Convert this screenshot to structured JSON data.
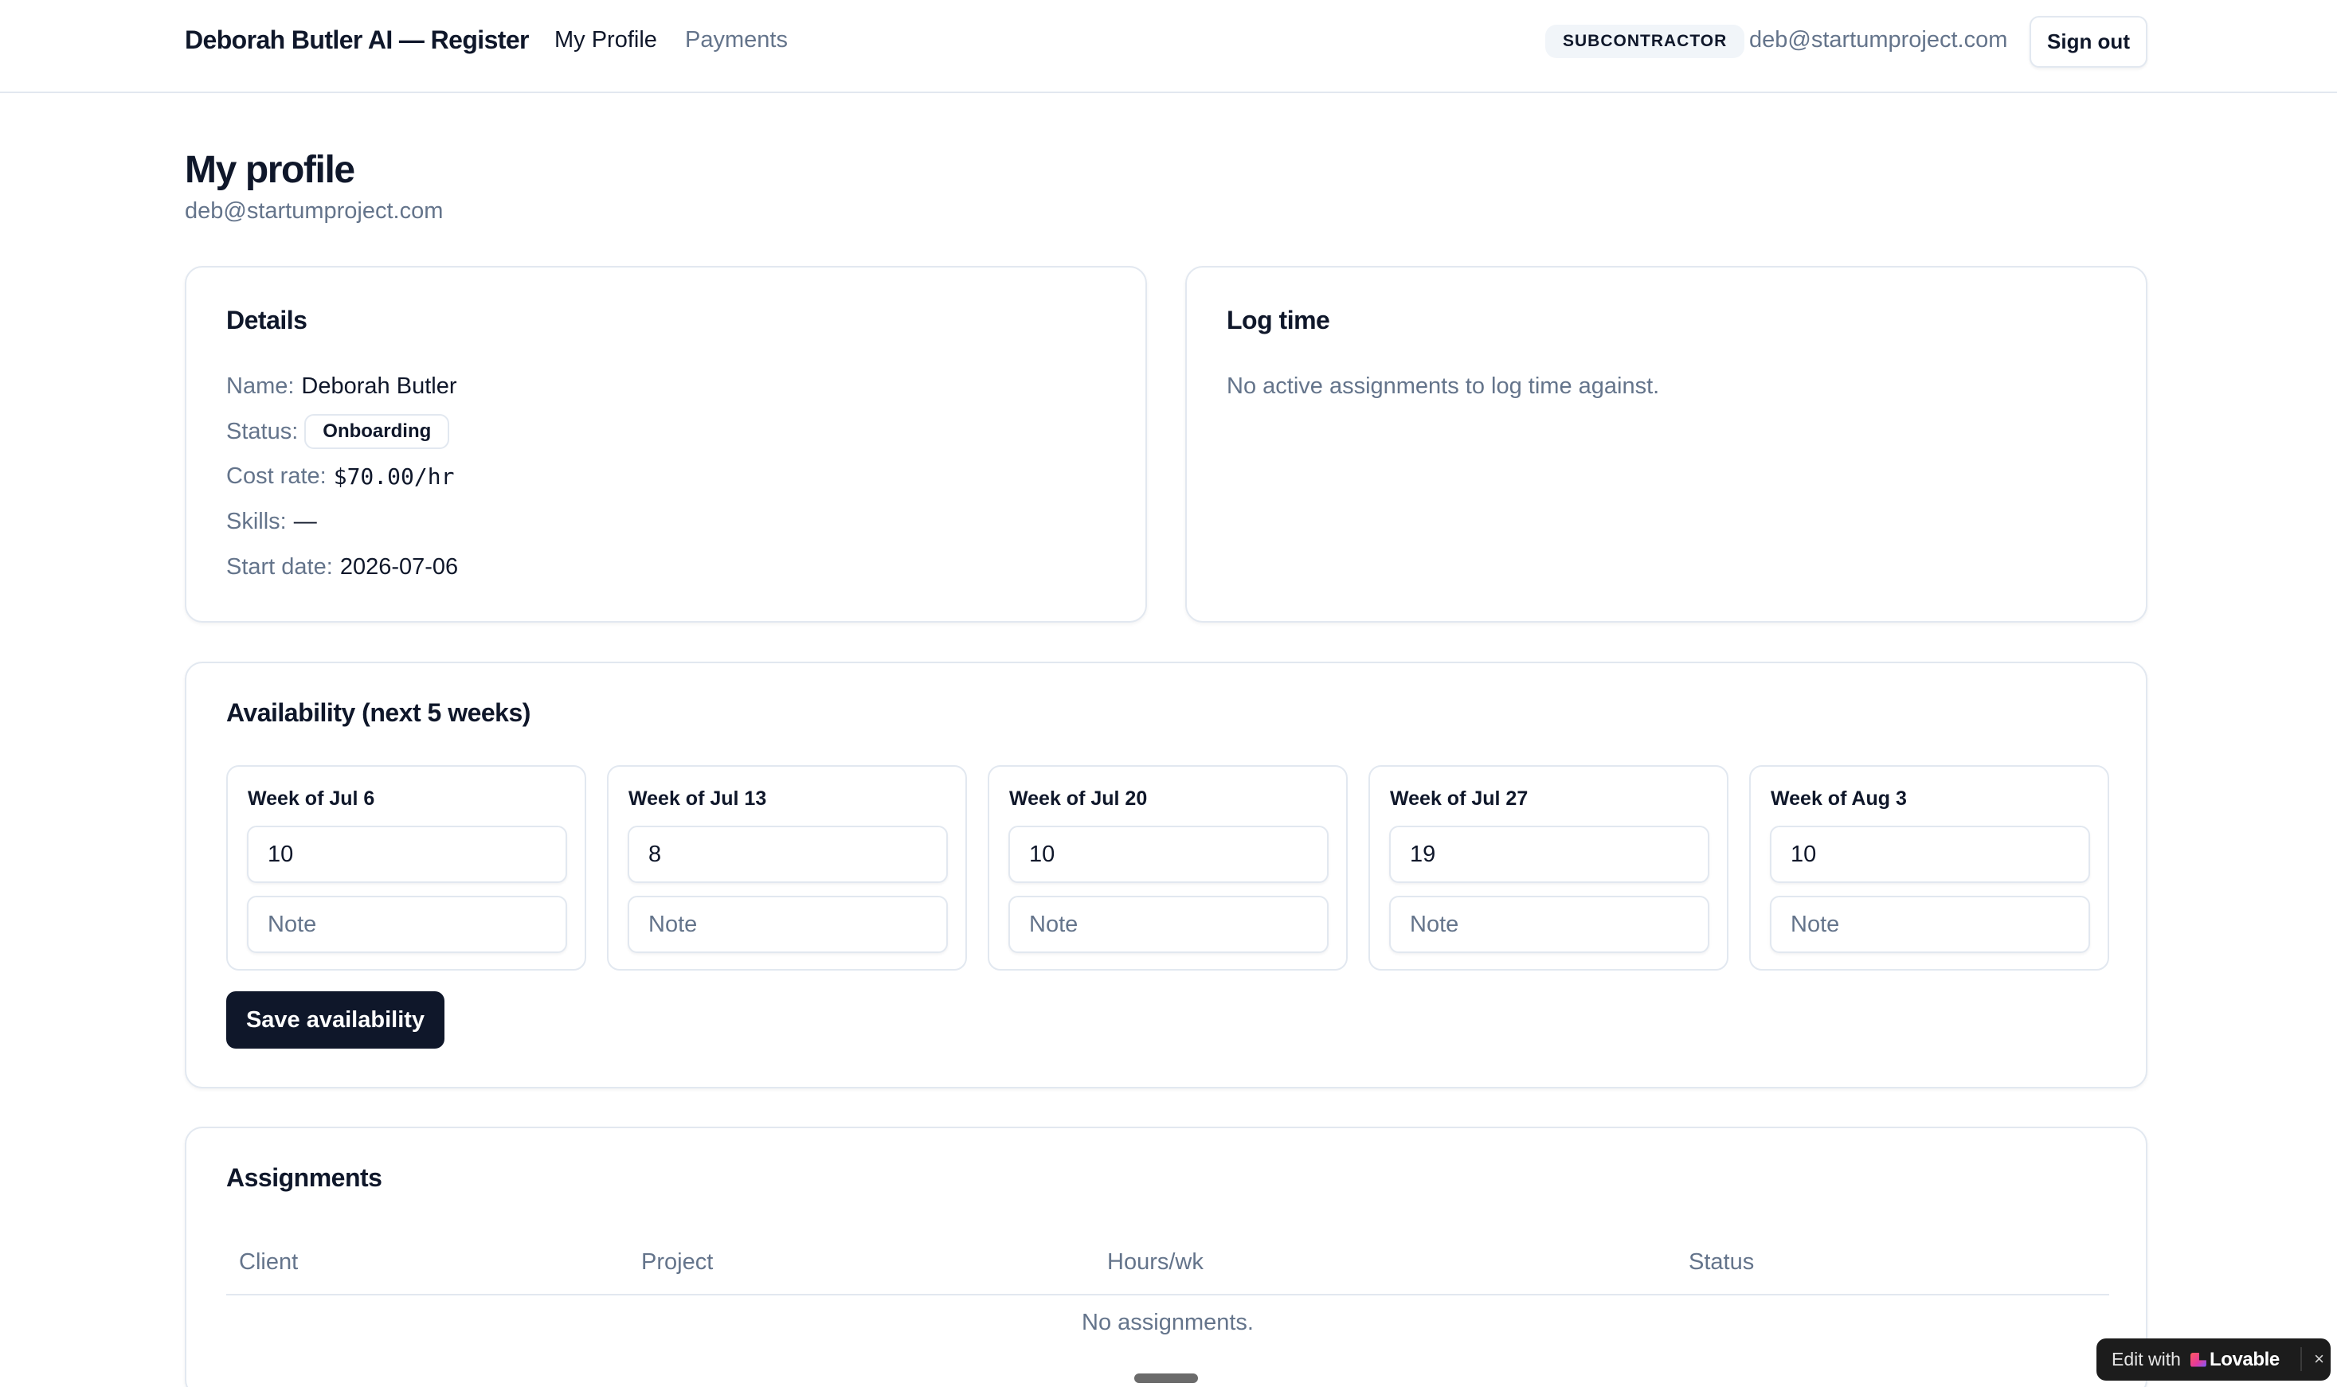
{
  "header": {
    "brand": "Deborah Butler AI — Register",
    "nav": {
      "profile": "My Profile",
      "payments": "Payments"
    },
    "role_badge": "SUBCONTRACTOR",
    "email": "deb@startumproject.com",
    "sign_out": "Sign out"
  },
  "page": {
    "title": "My profile",
    "subtitle": "deb@startumproject.com"
  },
  "details": {
    "title": "Details",
    "name_label": "Name:",
    "name": "Deborah Butler",
    "status_label": "Status:",
    "status": "Onboarding",
    "cost_label": "Cost rate:",
    "cost": "$70.00/hr",
    "skills_label": "Skills:",
    "skills": "—",
    "start_label": "Start date:",
    "start_date": "2026-07-06"
  },
  "log_time": {
    "title": "Log time",
    "empty": "No active assignments to log time against."
  },
  "availability": {
    "title": "Availability (next 5 weeks)",
    "note_placeholder": "Note",
    "weeks": [
      {
        "label": "Week of Jul 6",
        "hours": "10"
      },
      {
        "label": "Week of Jul 13",
        "hours": "8"
      },
      {
        "label": "Week of Jul 20",
        "hours": "10"
      },
      {
        "label": "Week of Jul 27",
        "hours": "19"
      },
      {
        "label": "Week of Aug 3",
        "hours": "10"
      }
    ],
    "save_label": "Save availability"
  },
  "assignments": {
    "title": "Assignments",
    "columns": [
      "Client",
      "Project",
      "Hours/wk",
      "Status"
    ],
    "empty": "No assignments."
  },
  "badge": {
    "edit_with": "Edit with",
    "brand": "Lovable",
    "close": "×"
  },
  "colors": {
    "primary": "#0f172a",
    "muted": "#64748b",
    "border": "#e2e8f0",
    "badge_bg": "#f1f5f9"
  }
}
